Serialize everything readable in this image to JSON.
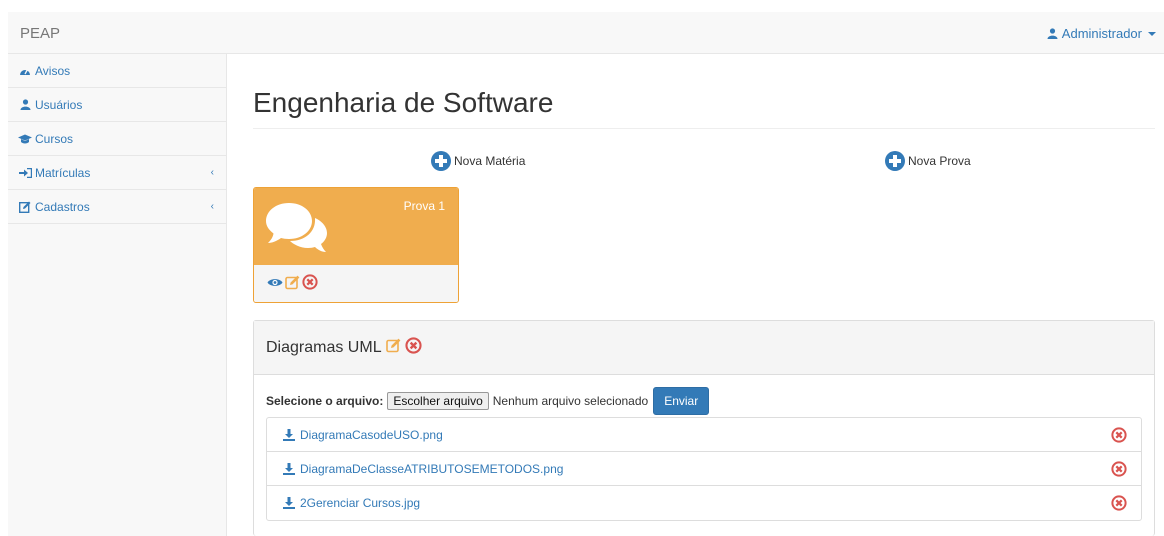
{
  "navbar": {
    "brand": "PEAP",
    "user": "Administrador"
  },
  "sidebar": {
    "items": [
      {
        "label": "Avisos",
        "icon": "dashboard-icon"
      },
      {
        "label": "Usuários",
        "icon": "user-icon"
      },
      {
        "label": "Cursos",
        "icon": "graduation-cap-icon"
      },
      {
        "label": "Matrículas",
        "icon": "sign-in-icon",
        "has_submenu": true
      },
      {
        "label": "Cadastros",
        "icon": "edit-icon",
        "has_submenu": true
      }
    ]
  },
  "main": {
    "title": "Engenharia de Software",
    "actions": {
      "new_subject": "Nova Matéria",
      "new_exam": "Nova Prova"
    },
    "exam_card": {
      "label": "Prova 1",
      "card_color": "#f0ad4e"
    },
    "panel": {
      "title": "Diagramas UML",
      "upload_label": "Selecione o arquivo:",
      "choose_file": "Escolher arquivo",
      "no_file": "Nenhum arquivo selecionado",
      "send": "Enviar",
      "files": [
        "DiagramaCasodeUSO.png",
        "DiagramaDeClasseATRIBUTOSEMETODOS.png",
        "2Gerenciar Cursos.jpg"
      ]
    }
  },
  "colors": {
    "link": "#337ab7",
    "warning": "#f0ad4e",
    "danger": "#d9534f"
  }
}
